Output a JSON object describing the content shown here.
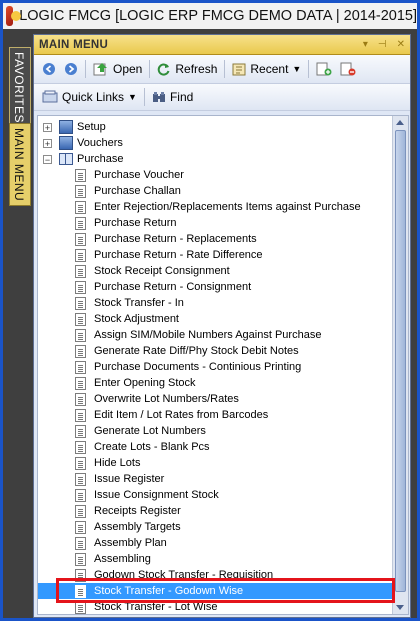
{
  "window": {
    "title": "LOGIC FMCG [LOGIC ERP FMCG DEMO DATA | 2014-2015]"
  },
  "side_tabs": [
    "FAVORITES",
    "MAIN MENU"
  ],
  "panel": {
    "title": "MAIN MENU",
    "controls": [
      "▾",
      "⊣",
      "✕"
    ]
  },
  "toolbar": {
    "open_label": "Open",
    "refresh_label": "Refresh",
    "recent_label": "Recent"
  },
  "toolbar2": {
    "quick_links_label": "Quick Links",
    "find_label": "Find"
  },
  "tree": {
    "top_nodes": [
      {
        "label": "Setup",
        "expander": "+"
      },
      {
        "label": "Vouchers",
        "expander": "+"
      },
      {
        "label": "Purchase",
        "expander": "−"
      }
    ],
    "purchase_items": [
      "Purchase Voucher",
      "Purchase Challan",
      "Enter Rejection/Replacements Items against Purchase",
      "Purchase Return",
      "Purchase Return - Replacements",
      "Purchase Return - Rate Difference",
      "Stock Receipt Consignment",
      "Purchase Return - Consignment",
      "Stock Transfer - In",
      "Stock Adjustment",
      "Assign SIM/Mobile Numbers Against Purchase",
      "Generate Rate Diff/Phy Stock Debit Notes",
      "Purchase Documents - Continious Printing",
      "Enter Opening Stock",
      "Overwrite Lot Numbers/Rates",
      "Edit Item / Lot Rates from Barcodes",
      "Generate Lot Numbers",
      "Create Lots - Blank Pcs",
      "Hide Lots",
      "Issue Register",
      "Issue Consignment Stock",
      "Receipts Register",
      "Assembly Targets",
      "Assembly Plan",
      "Assembling",
      "Godown Stock Transfer - Requisition",
      "Stock Transfer - Godown Wise",
      "Stock Transfer - Lot Wise"
    ],
    "selected_item": "Stock Transfer - Godown Wise"
  },
  "colors": {
    "selection": "#3399ff",
    "highlight_box": "#e4141b",
    "header_gold": "#e9c94d"
  }
}
